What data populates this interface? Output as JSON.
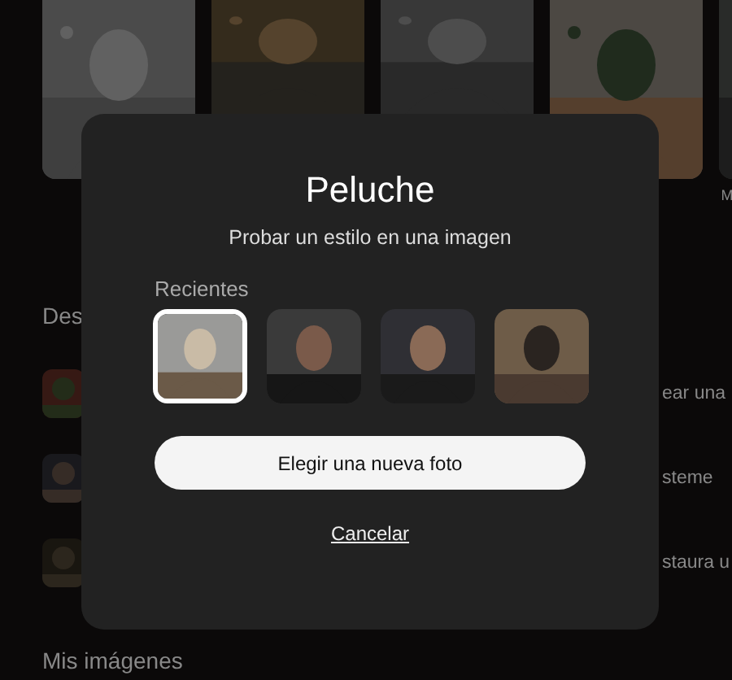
{
  "gallery": [
    {
      "kind": "picture"
    },
    {
      "kind": "picture"
    },
    {
      "kind": "picture"
    },
    {
      "kind": "picture"
    },
    {
      "kind": "picture",
      "label": "M"
    }
  ],
  "section": {
    "title": "Des",
    "rows": [
      {
        "text": "ear una"
      },
      {
        "text": "steme"
      },
      {
        "text": "staura u"
      }
    ]
  },
  "footer_title": "Mis imágenes",
  "dialog": {
    "title": "Peluche",
    "subtitle": "Probar un estilo en una imagen",
    "recent_label": "Recientes",
    "recents": [
      {
        "selected": true
      },
      {
        "selected": false
      },
      {
        "selected": false
      },
      {
        "selected": false
      }
    ],
    "primary_button": "Elegir una nueva foto",
    "cancel": "Cancelar"
  }
}
